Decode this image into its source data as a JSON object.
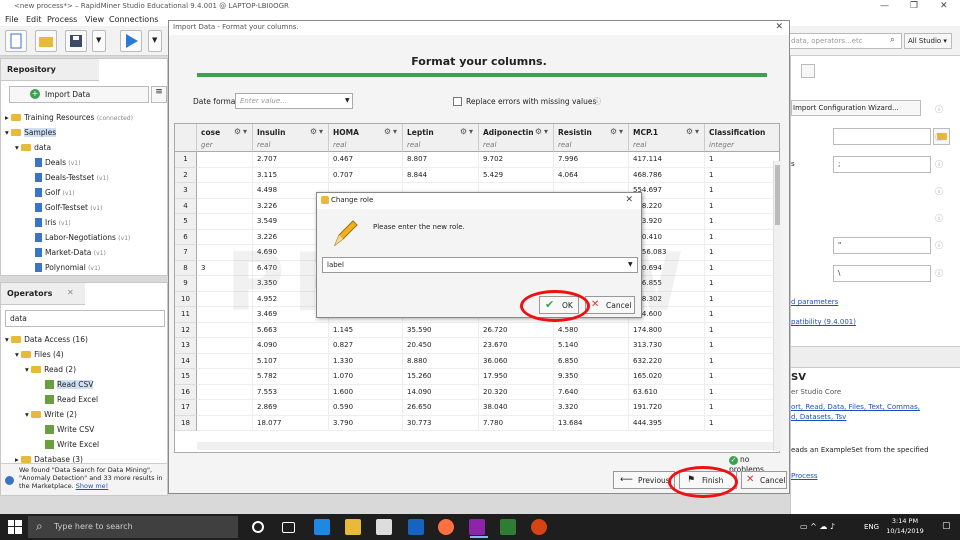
{
  "window": {
    "title": "<new process*> – RapidMiner Studio Educational 9.4.001 @ LAPTOP-LBI0OGR",
    "controls": [
      "—",
      "❐",
      "✕"
    ]
  },
  "menu": [
    "File",
    "Edit",
    "Process",
    "View",
    "Connections",
    "Settings",
    "Extensions",
    "Help"
  ],
  "toolbar": {
    "search_placeholder": "data, operators...etc",
    "all_studio": "All Studio ▾"
  },
  "repository": {
    "tab": "Repository",
    "import_button": "Import Data",
    "items": [
      {
        "label": "Training Resources",
        "note": "(connected)"
      },
      {
        "label": "Samples",
        "note": ""
      },
      {
        "label": "data",
        "note": ""
      },
      {
        "label": "Deals",
        "note": "(v1)"
      },
      {
        "label": "Deals-Testset",
        "note": "(v1)"
      },
      {
        "label": "Golf",
        "note": "(v1)"
      },
      {
        "label": "Golf-Testset",
        "note": "(v1)"
      },
      {
        "label": "Iris",
        "note": "(v1)"
      },
      {
        "label": "Labor-Negotiations",
        "note": "(v1)"
      },
      {
        "label": "Market-Data",
        "note": "(v1)"
      },
      {
        "label": "Polynomial",
        "note": "(v1)"
      }
    ]
  },
  "operators": {
    "tab": "Operators",
    "search_value": "data",
    "items": [
      "Data Access (16)",
      "Files (4)",
      "Read (2)",
      "Read CSV",
      "Read Excel",
      "Write (2)",
      "Write CSV",
      "Write Excel",
      "Database (3)"
    ],
    "footer": "We found \"Data Search for Data Mining\", \"Anomaly Detection\" and 33 more results in the Marketplace.",
    "show_me": "Show me!"
  },
  "dialog": {
    "title": "Import Data - Format your columns.",
    "heading": "Format your columns.",
    "date_format_label": "Date format",
    "date_format_placeholder": "Enter value...",
    "replace_errors_label": "Replace errors with missing values",
    "status": "no problems.",
    "buttons": {
      "previous": "Previous",
      "finish": "Finish",
      "cancel": "Cancel"
    }
  },
  "table": {
    "columns": [
      {
        "name": "cose",
        "type": "ger"
      },
      {
        "name": "Insulin",
        "type": "real"
      },
      {
        "name": "HOMA",
        "type": "real"
      },
      {
        "name": "Leptin",
        "type": "real"
      },
      {
        "name": "Adiponectin",
        "type": "real"
      },
      {
        "name": "Resistin",
        "type": "real"
      },
      {
        "name": "MCP.1",
        "type": "real"
      },
      {
        "name": "Classification",
        "type": "integer"
      }
    ],
    "rows": [
      [
        "1",
        "",
        "2.707",
        "0.467",
        "8.807",
        "9.702",
        "7.996",
        "417.114",
        "1"
      ],
      [
        "2",
        "",
        "3.115",
        "0.707",
        "8.844",
        "5.429",
        "4.064",
        "468.786",
        "1"
      ],
      [
        "3",
        "",
        "4.498",
        "",
        "",
        "",
        "",
        "554.697",
        "1"
      ],
      [
        "4",
        "",
        "3.226",
        "",
        "",
        "",
        "",
        "928.220",
        "1"
      ],
      [
        "5",
        "",
        "3.549",
        "",
        "",
        "",
        "",
        "773.920",
        "1"
      ],
      [
        "6",
        "",
        "3.226",
        "",
        "",
        "",
        "",
        "530.410",
        "1"
      ],
      [
        "7",
        "",
        "4.690",
        "",
        "",
        "",
        "",
        "1256.083",
        "1"
      ],
      [
        "8",
        "3",
        "6.470",
        "",
        "",
        "",
        "",
        "280.694",
        "1"
      ],
      [
        "9",
        "",
        "3.350",
        "",
        "",
        "",
        "",
        "136.855",
        "1"
      ],
      [
        "10",
        "",
        "4.952",
        "",
        "",
        "",
        "",
        "318.302",
        "1"
      ],
      [
        "11",
        "",
        "3.469",
        "0.667",
        "14.570",
        "13.110",
        "6.920",
        "354.600",
        "1"
      ],
      [
        "12",
        "",
        "5.663",
        "1.145",
        "35.590",
        "26.720",
        "4.580",
        "174.800",
        "1"
      ],
      [
        "13",
        "",
        "4.090",
        "0.827",
        "20.450",
        "23.670",
        "5.140",
        "313.730",
        "1"
      ],
      [
        "14",
        "",
        "5.107",
        "1.330",
        "8.880",
        "36.060",
        "6.850",
        "632.220",
        "1"
      ],
      [
        "15",
        "",
        "5.782",
        "1.070",
        "15.260",
        "17.950",
        "9.350",
        "165.020",
        "1"
      ],
      [
        "16",
        "",
        "7.553",
        "1.600",
        "14.090",
        "20.320",
        "7.640",
        "63.610",
        "1"
      ],
      [
        "17",
        "",
        "2.869",
        "0.590",
        "26.650",
        "38.040",
        "3.320",
        "191.720",
        "1"
      ],
      [
        "18",
        "",
        "18.077",
        "3.790",
        "30.773",
        "7.780",
        "13.684",
        "444.395",
        "1"
      ]
    ]
  },
  "change_role": {
    "title": "Change role",
    "prompt": "Please enter the new role.",
    "value": "label",
    "ok": "OK",
    "cancel": "Cancel"
  },
  "right_panel": {
    "wizard_button": "Import Configuration Wizard...",
    "field_labels": [
      "s"
    ],
    "field_values": [
      "",
      ";",
      "\"",
      "\\"
    ],
    "link1": "d parameters",
    "link2": "patibility (9.4.001)",
    "help_title": "SV",
    "help_sub": "er Studio Core",
    "tags": "ort, Read, Data, Files, Text, Commas, d, Datasets, Tsv",
    "desc": "eads an ExampleSet from the specified",
    "process_link": "Process"
  },
  "taskbar": {
    "search": "Type here to search",
    "time": "3:14 PM",
    "date": "10/14/2019",
    "lang": "ENG"
  },
  "watermark": "PREVIEW"
}
